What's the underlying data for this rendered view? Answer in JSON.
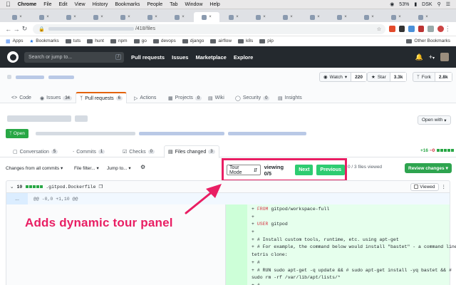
{
  "menubar": {
    "items": [
      "Chrome",
      "File",
      "Edit",
      "View",
      "History",
      "Bookmarks",
      "People",
      "Tab",
      "Window",
      "Help"
    ],
    "battery": "53%",
    "user": "DSK"
  },
  "addressbar": {
    "url_suffix": "/418/files"
  },
  "bookmarks": {
    "items": [
      "Apps",
      "Bookmarks",
      "tuts",
      "hunt",
      "npm",
      "go",
      "devops",
      "django",
      "airflow",
      "k8s",
      "pip"
    ],
    "other": "Other Bookmarks"
  },
  "github": {
    "search_placeholder": "Search or jump to...",
    "search_key": "/",
    "nav": [
      "Pull requests",
      "Issues",
      "Marketplace",
      "Explore"
    ],
    "plus": "+"
  },
  "repo": {
    "watch_label": "Watch",
    "watch_count": "220",
    "star_label": "Star",
    "star_count": "3.3k",
    "fork_label": "Fork",
    "fork_count": "2.8k",
    "tabs": [
      {
        "label": "Code",
        "count": ""
      },
      {
        "label": "Issues",
        "count": "34"
      },
      {
        "label": "Pull requests",
        "count": "6"
      },
      {
        "label": "Actions",
        "count": ""
      },
      {
        "label": "Projects",
        "count": "0"
      },
      {
        "label": "Wiki",
        "count": ""
      },
      {
        "label": "Security",
        "count": "0"
      },
      {
        "label": "Insights",
        "count": ""
      }
    ]
  },
  "pr": {
    "status": "Open",
    "open_with": "Open with",
    "tabs": [
      {
        "label": "Conversation",
        "count": "5"
      },
      {
        "label": "Commits",
        "count": "1"
      },
      {
        "label": "Checks",
        "count": "0"
      },
      {
        "label": "Files changed",
        "count": "3"
      }
    ],
    "additions": "+16",
    "deletions": "−0"
  },
  "toolbar": {
    "changes_from": "Changes from all commits",
    "file_filter": "File filter...",
    "jump_to": "Jump to...",
    "files_viewed": "0 / 3 files viewed",
    "review_changes": "Review changes"
  },
  "tour": {
    "mode": "Tour Mode",
    "viewing": "viewing 0/5",
    "next": "Next",
    "previous": "Previous"
  },
  "file": {
    "changes": "10",
    "name": ".gitpod.Dockerfile",
    "viewed": "Viewed",
    "expand": "...",
    "hunk": "@@ -0,0 +1,10 @@",
    "lines": [
      {
        "kw": "FROM",
        "rest": " gitpod/workspace-full"
      },
      {
        "kw": "",
        "rest": ""
      },
      {
        "kw": "USER",
        "rest": " gitpod"
      },
      {
        "kw": "",
        "rest": ""
      },
      {
        "kw": "",
        "rest": "# Install custom tools, runtime, etc. using apt-get"
      },
      {
        "kw": "",
        "rest": "# For example, the command below would install \"bastet\" - a command line"
      },
      {
        "kw": "",
        "rest": "tetris clone:",
        "wrap": true
      },
      {
        "kw": "",
        "rest": "#"
      },
      {
        "kw": "",
        "rest": "# RUN sudo apt-get -q update && #     sudo apt-get install -yq bastet && #"
      },
      {
        "kw": "",
        "rest": "sudo rm -rf /var/lib/apt/lists/*",
        "wrap": true
      },
      {
        "kw": "",
        "rest": "#"
      }
    ]
  },
  "annotation": "Adds dynamic tour panel",
  "colors": {
    "accent": "#e91e63",
    "github_dark": "#24292e",
    "green": "#28a745",
    "tour_green": "#2ecc71"
  }
}
